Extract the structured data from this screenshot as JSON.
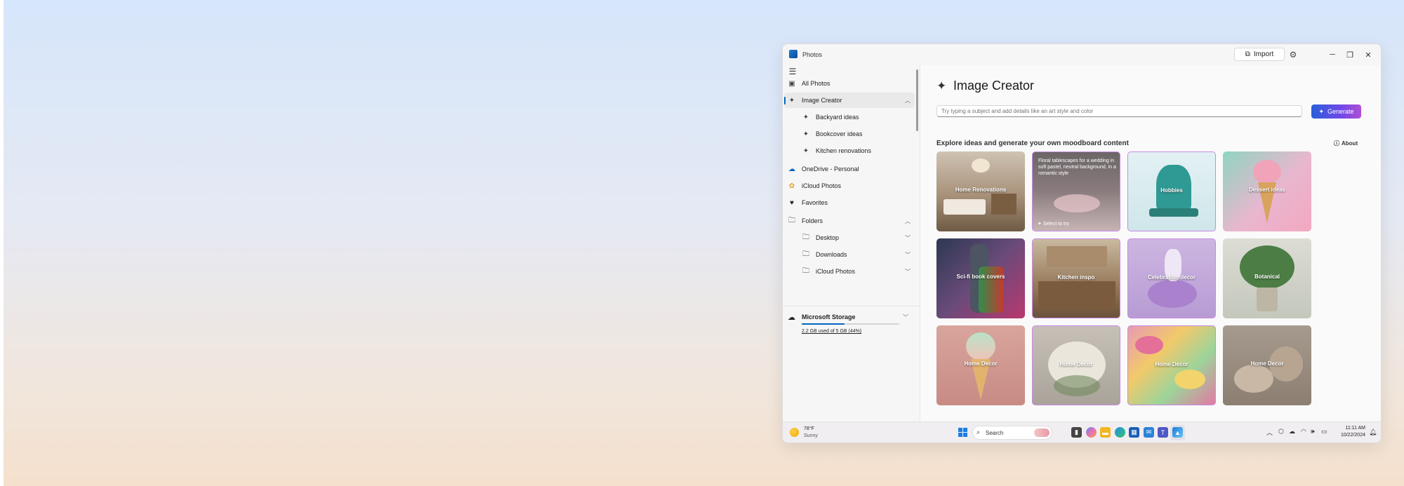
{
  "window": {
    "title": "Photos"
  },
  "titlebar": {
    "import_label": "Import"
  },
  "sidebar": {
    "items": [
      {
        "label": "All Photos",
        "icon": "photos-icon"
      },
      {
        "label": "Image Creator",
        "icon": "image-creator-icon",
        "selected": true,
        "expanded": true
      },
      {
        "label": "Backyard ideas",
        "icon": "image-creator-icon"
      },
      {
        "label": "Bookcover ideas",
        "icon": "image-creator-icon"
      },
      {
        "label": "Kitchen renovations",
        "icon": "image-creator-icon"
      },
      {
        "label": "OneDrive - Personal",
        "icon": "onedrive-icon"
      },
      {
        "label": "iCloud Photos",
        "icon": "icloud-icon"
      },
      {
        "label": "Favorites",
        "icon": "heart-icon"
      },
      {
        "label": "Folders",
        "icon": "folder-icon",
        "expanded": true
      },
      {
        "label": "Desktop",
        "icon": "folder-icon"
      },
      {
        "label": "Downloads",
        "icon": "folder-icon"
      },
      {
        "label": "iCloud Photos",
        "icon": "folder-icon"
      }
    ],
    "storage": {
      "title": "Microsoft Storage",
      "used_text": "2.2 GB used of 5 GB (44%)",
      "fraction": 0.44
    }
  },
  "main": {
    "title": "Image Creator",
    "prompt_placeholder": "Try typing a subject and add details like an art style and color",
    "generate_label": "Generate",
    "explore_text": "Explore ideas and generate your own moodboard content",
    "about_label": "About",
    "tiles": [
      {
        "label": "Home Renovations"
      },
      {
        "label": "",
        "description": "Floral tablescapes for a wedding in soft pastel, neutral background, in a romantic style",
        "hint": "Select to try"
      },
      {
        "label": "Hobbies"
      },
      {
        "label": "Dessert ideas"
      },
      {
        "label": "Sci-fi book covers"
      },
      {
        "label": "Kitchen inspo"
      },
      {
        "label": "Celebration decor"
      },
      {
        "label": "Botanical"
      },
      {
        "label": "Home Decor"
      },
      {
        "label": "Home Decor"
      },
      {
        "label": "Home Decor"
      },
      {
        "label": "Home Decor"
      }
    ]
  },
  "taskbar": {
    "weather_temp": "78°F",
    "weather_condition": "Sunny",
    "search_label": "Search",
    "time": "11:11 AM",
    "date": "10/22/2024"
  },
  "colors": {
    "accent": "#0067c0",
    "generate_start": "#2a5fd9",
    "generate_end": "#b04fd4"
  }
}
